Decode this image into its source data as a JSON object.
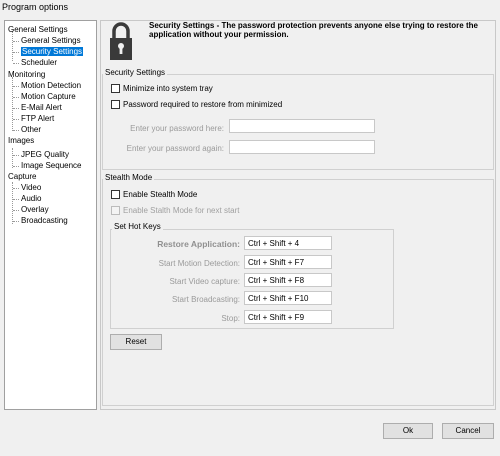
{
  "window": {
    "title": "Program options"
  },
  "tree": {
    "items": [
      {
        "label": "General Settings",
        "level": 0
      },
      {
        "label": "General Settings",
        "level": 1
      },
      {
        "label": "Security Settings",
        "level": 1,
        "selected": true
      },
      {
        "label": "Scheduler",
        "level": 1
      },
      {
        "label": "Monitoring",
        "level": 0
      },
      {
        "label": "Motion Detection",
        "level": 1
      },
      {
        "label": "Motion Capture",
        "level": 1
      },
      {
        "label": "E-Mail Alert",
        "level": 1
      },
      {
        "label": "FTP Alert",
        "level": 1
      },
      {
        "label": "Other",
        "level": 1
      },
      {
        "label": "Images",
        "level": 0
      },
      {
        "label": "JPEG Quality",
        "level": 1
      },
      {
        "label": "Image Sequence",
        "level": 1
      },
      {
        "label": "Capture",
        "level": 0
      },
      {
        "label": "Video",
        "level": 1
      },
      {
        "label": "Audio",
        "level": 1
      },
      {
        "label": "Overlay",
        "level": 1
      },
      {
        "label": "Broadcasting",
        "level": 1
      }
    ]
  },
  "header": {
    "description": "Security Settings - The password protection prevents anyone else trying to restore the application without your permission."
  },
  "security": {
    "group_label": "Security Settings",
    "minimize_tray_label": "Minimize into system tray",
    "minimize_tray_checked": false,
    "password_required_label": "Password required to restore from minimized",
    "password_required_checked": false,
    "password_label": "Enter your password here:",
    "password_value": "",
    "password_again_label": "Enter your password again:",
    "password_again_value": ""
  },
  "stealth": {
    "group_label": "Stealth Mode",
    "enable_label": "Enable Stealth Mode",
    "enable_checked": false,
    "next_start_label": "Enable Stalth Mode for next start",
    "next_start_checked": false
  },
  "hotkeys": {
    "group_label": "Set Hot Keys",
    "restore_label": "Restore Application:",
    "restore_value": "Ctrl + Shift + 4",
    "motion_label": "Start Motion Detection:",
    "motion_value": "Ctrl + Shift + F7",
    "video_label": "Start Video capture:",
    "video_value": "Ctrl + Shift + F8",
    "broadcast_label": "Start Broadcasting:",
    "broadcast_value": "Ctrl + Shift + F10",
    "stop_label": "Stop:",
    "stop_value": "Ctrl + Shift + F9",
    "reset_label": "Reset"
  },
  "footer": {
    "ok_label": "Ok",
    "cancel_label": "Cancel"
  }
}
